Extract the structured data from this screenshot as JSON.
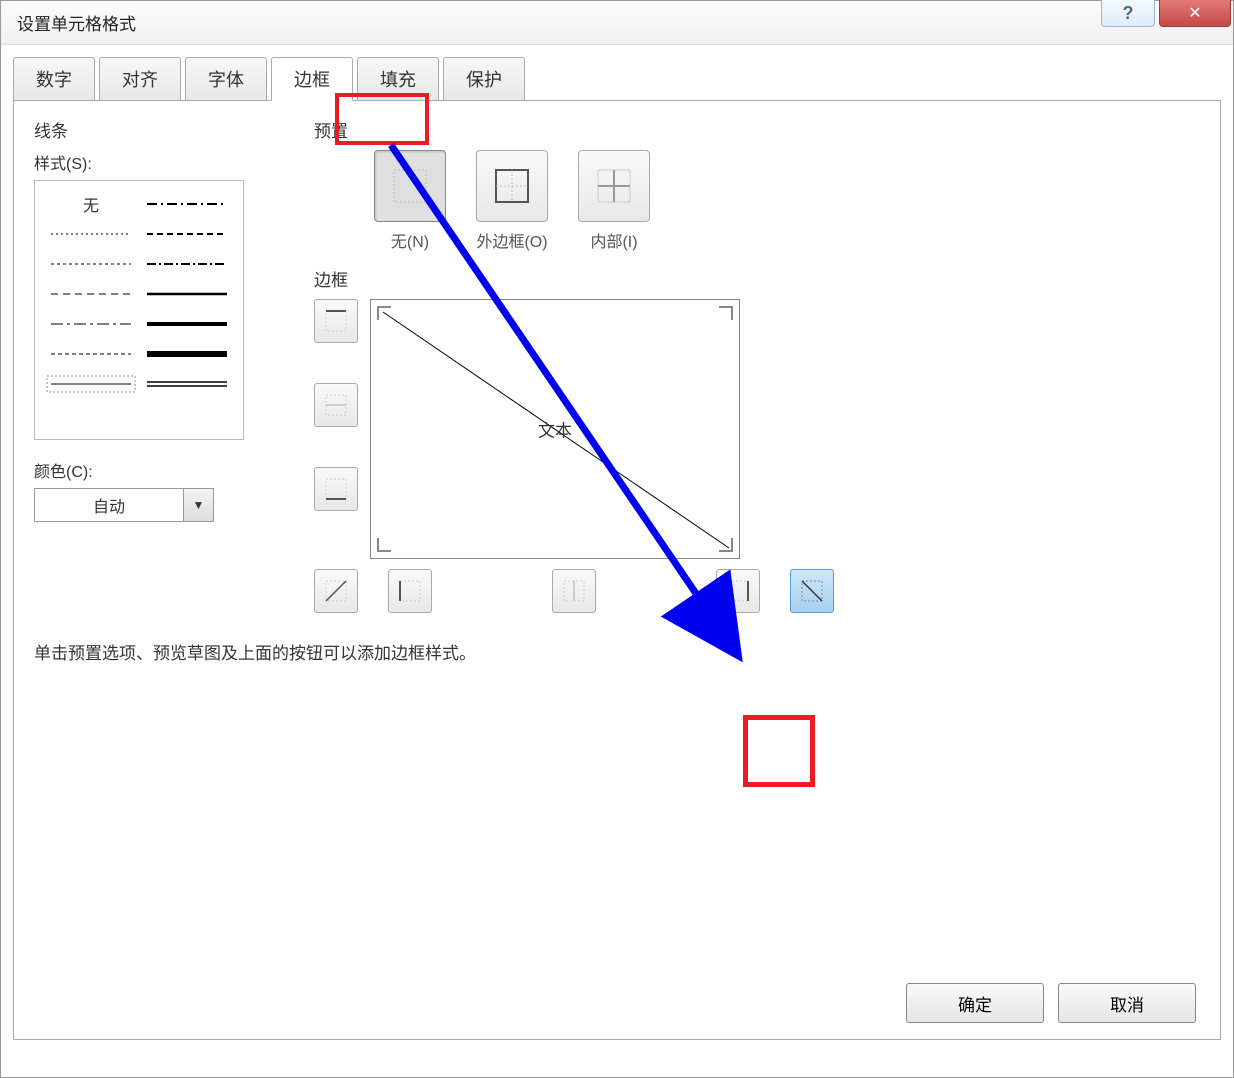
{
  "window": {
    "title": "设置单元格格式"
  },
  "tabs": {
    "number": "数字",
    "alignment": "对齐",
    "font": "字体",
    "border": "边框",
    "fill": "填充",
    "protection": "保护"
  },
  "lines": {
    "group_label": "线条",
    "style_label": "样式(S):",
    "none": "无",
    "color_label": "颜色(C):",
    "color_auto": "自动"
  },
  "presets": {
    "group_label": "预置",
    "none": "无(N)",
    "outline": "外边框(O)",
    "inside": "内部(I)"
  },
  "border": {
    "group_label": "边框",
    "preview_text": "文本"
  },
  "hint": "单击预置选项、预览草图及上面的按钮可以添加边框样式。",
  "footer": {
    "ok": "确定",
    "cancel": "取消"
  }
}
